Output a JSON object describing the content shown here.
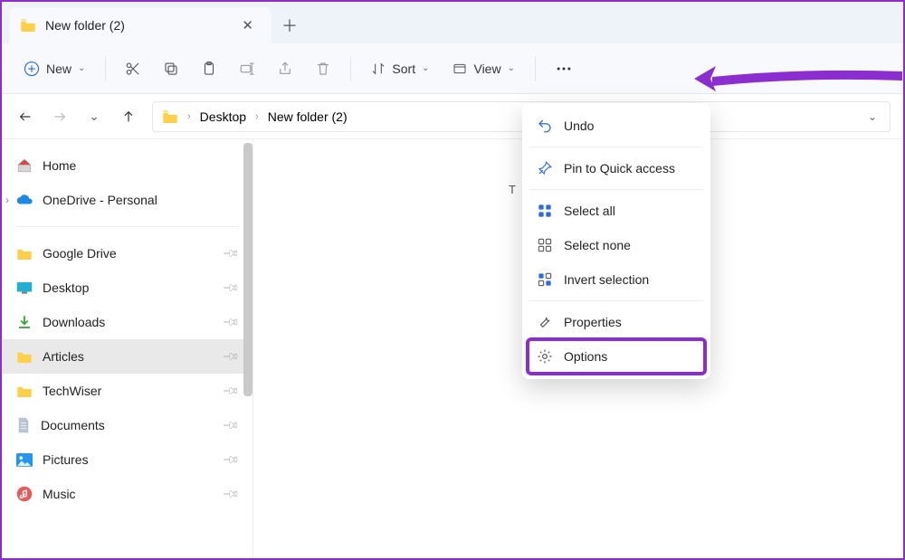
{
  "tab": {
    "title": "New folder (2)"
  },
  "toolbar": {
    "new_label": "New",
    "sort_label": "Sort",
    "view_label": "View"
  },
  "breadcrumb": {
    "items": [
      "Desktop",
      "New folder (2)"
    ]
  },
  "sidebar": {
    "home": "Home",
    "onedrive": "OneDrive - Personal",
    "pinned": [
      {
        "label": "Google Drive"
      },
      {
        "label": "Desktop"
      },
      {
        "label": "Downloads"
      },
      {
        "label": "Articles"
      },
      {
        "label": "TechWiser"
      },
      {
        "label": "Documents"
      },
      {
        "label": "Pictures"
      },
      {
        "label": "Music"
      }
    ]
  },
  "content": {
    "truncated_text": "T"
  },
  "menu": {
    "undo": "Undo",
    "pin": "Pin to Quick access",
    "select_all": "Select all",
    "select_none": "Select none",
    "invert": "Invert selection",
    "properties": "Properties",
    "options": "Options"
  },
  "colors": {
    "accent": "#8b2dd0",
    "blue": "#2b6be4"
  }
}
